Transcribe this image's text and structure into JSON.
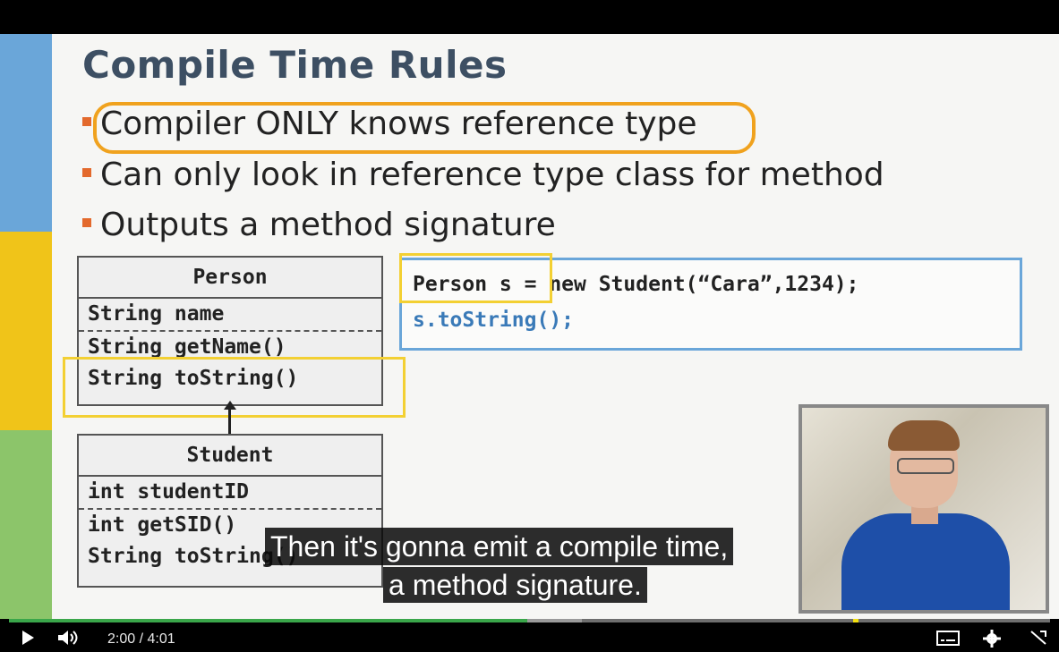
{
  "slide": {
    "title": "Compile Time Rules",
    "bullets": [
      "Compiler ONLY knows reference type",
      "Can only look in reference type class for method",
      "Outputs a method signature"
    ],
    "person_class": {
      "name": "Person",
      "field": "String name",
      "method1": "String getName()",
      "method2": "String toString()"
    },
    "student_class": {
      "name": "Student",
      "field": "int studentID",
      "method1": "int getSID()",
      "method2": "String toString()"
    },
    "code": {
      "line1": "Person s = new Student(“Cara”,1234);",
      "line2": "s.toString();"
    },
    "colors": {
      "stripe_blue": "#6aa6d9",
      "stripe_yellow": "#f0c419",
      "stripe_green": "#8cc56a",
      "highlight_orange": "#f0a21e",
      "highlight_yellow": "#f3d033",
      "code_blue": "#3a7ab8"
    }
  },
  "captions": {
    "line1": "Then it's gonna emit a compile time,",
    "line2": "a method signature."
  },
  "player": {
    "current_time": "2:00",
    "separator": "/",
    "duration": "4:01",
    "progress_fraction": 0.498,
    "play_icon": "play-icon",
    "volume_icon": "volume-icon",
    "subtitles_icon": "subtitles-icon",
    "settings_icon": "gear-icon",
    "fullscreen_icon": "fullscreen-icon"
  }
}
